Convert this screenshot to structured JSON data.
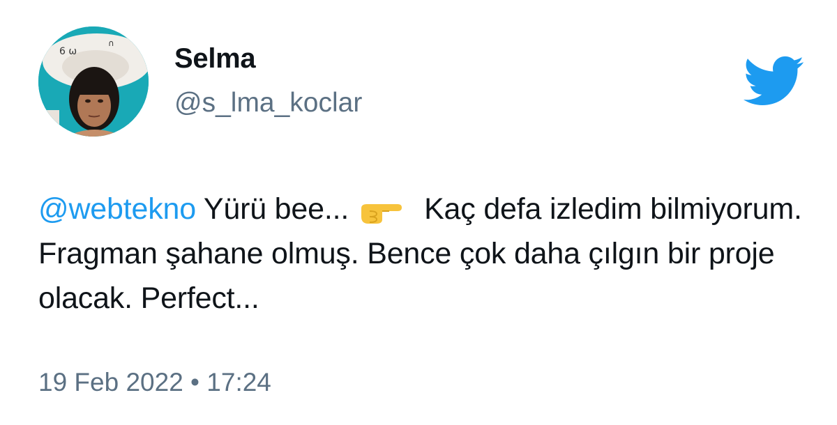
{
  "user": {
    "display_name": "Selma",
    "handle": "@s_lma_koclar",
    "avatar_icon": "profile-photo"
  },
  "brand": {
    "icon": "twitter-bird-icon",
    "color": "#1d9bf0"
  },
  "tweet": {
    "mention": "@webtekno",
    "text_before_emoji": " Yürü bee...",
    "emoji": "pointing-right-hand",
    "text_after_emoji": "Kaç defa izledim bilmiyorum. Fragman şahane olmuş. Bence çok daha çılgın bir proje olacak. Perfect..."
  },
  "meta": {
    "timestamp": "19 Feb 2022 • 17:24"
  }
}
